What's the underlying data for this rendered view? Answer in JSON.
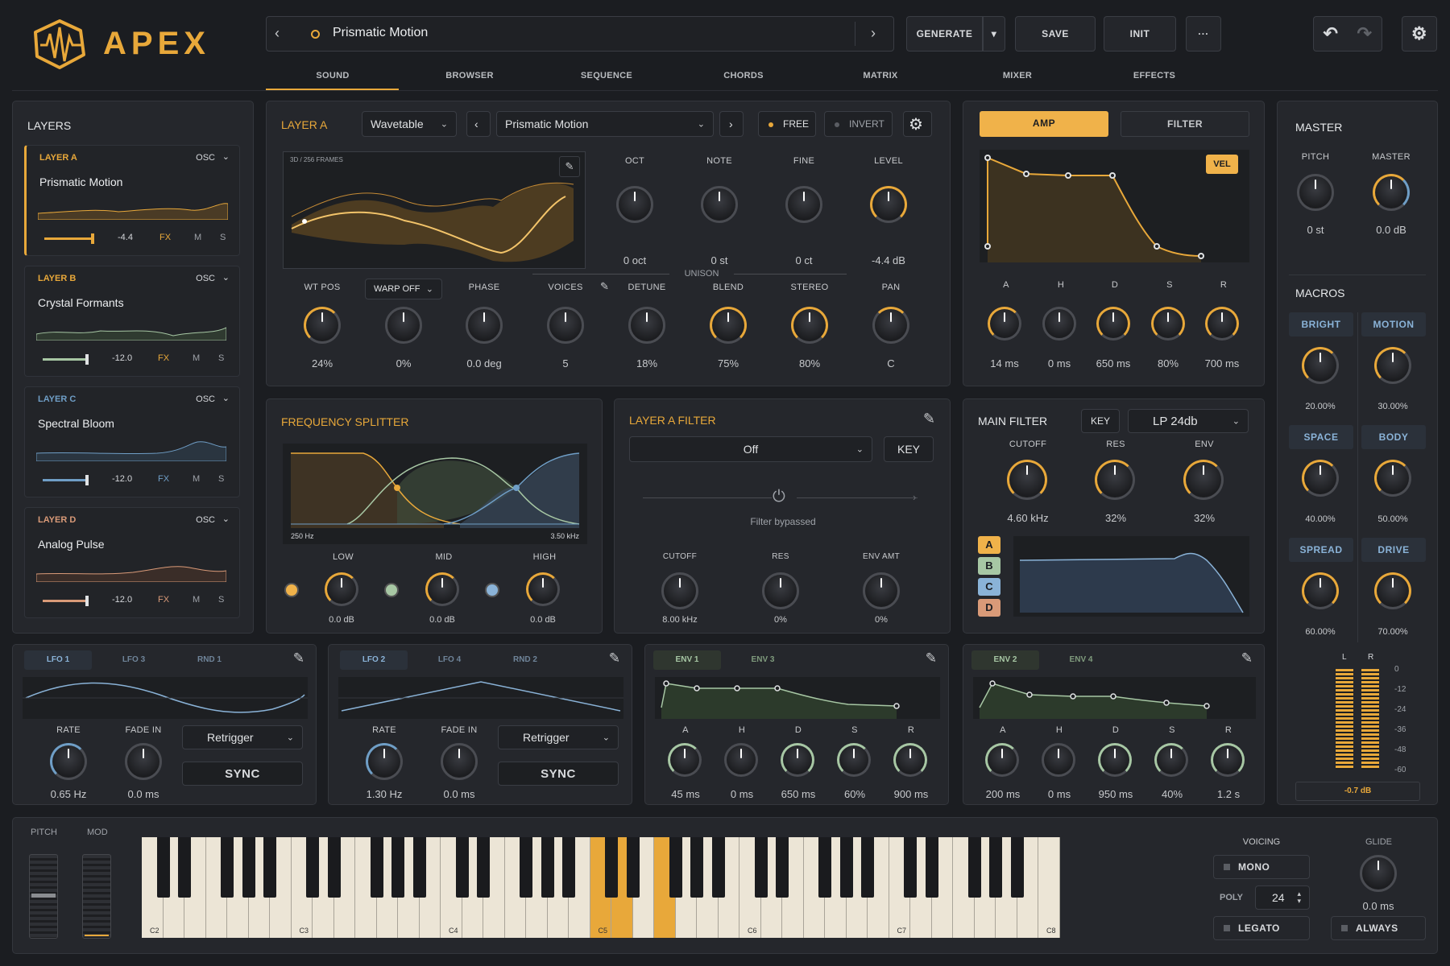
{
  "app": {
    "name": "APEX"
  },
  "colors": {
    "accent": "#e8a83a",
    "bg": "#1b1d21",
    "panel": "#25272c",
    "blue": "#6f9ec6",
    "green": "#a7c7a4",
    "peach": "#d99a78"
  },
  "preset": {
    "name": "Prismatic Motion"
  },
  "toolbar": {
    "generate": "GENERATE",
    "save": "SAVE",
    "init": "INIT",
    "more": "···"
  },
  "tabs": [
    "SOUND",
    "BROWSER",
    "SEQUENCE",
    "CHORDS",
    "MATRIX",
    "MIXER",
    "EFFECTS"
  ],
  "layers": {
    "title": "LAYERS",
    "items": [
      {
        "id": "LAYER A",
        "type": "OSC",
        "name": "Prismatic Motion",
        "level": "-4.4",
        "fx": "FX",
        "m": "M",
        "s": "S"
      },
      {
        "id": "LAYER B",
        "type": "OSC",
        "name": "Crystal Formants",
        "level": "-12.0",
        "fx": "FX",
        "m": "M",
        "s": "S"
      },
      {
        "id": "LAYER C",
        "type": "OSC",
        "name": "Spectral Bloom",
        "level": "-12.0",
        "fx": "FX",
        "m": "M",
        "s": "S"
      },
      {
        "id": "LAYER D",
        "type": "OSC",
        "name": "Analog Pulse",
        "level": "-12.0",
        "fx": "FX",
        "m": "M",
        "s": "S"
      }
    ]
  },
  "layerA": {
    "title": "LAYER A",
    "engine": "Wavetable",
    "wavetable": "Prismatic Motion",
    "free": "FREE",
    "invert": "INVERT",
    "wt_caption": "3D / 256 FRAMES",
    "top_knobs": [
      {
        "label": "OCT",
        "value": "0 oct"
      },
      {
        "label": "NOTE",
        "value": "0 st"
      },
      {
        "label": "FINE",
        "value": "0 ct"
      },
      {
        "label": "LEVEL",
        "value": "-4.4 dB"
      }
    ],
    "unison": "UNISON",
    "warp": "WARP OFF",
    "bottom_knobs": [
      {
        "label": "WT POS",
        "value": "24%"
      },
      {
        "label": "",
        "value": "0%"
      },
      {
        "label": "PHASE",
        "value": "0.0 deg"
      },
      {
        "label": "VOICES",
        "value": "5"
      },
      {
        "label": "DETUNE",
        "value": "18%"
      },
      {
        "label": "BLEND",
        "value": "75%"
      },
      {
        "label": "STEREO",
        "value": "80%"
      },
      {
        "label": "PAN",
        "value": "C"
      }
    ]
  },
  "amp": {
    "tab_amp": "AMP",
    "tab_filter": "FILTER",
    "vel": "VEL",
    "knobs": [
      {
        "label": "A",
        "value": "14 ms"
      },
      {
        "label": "H",
        "value": "0 ms"
      },
      {
        "label": "D",
        "value": "650 ms"
      },
      {
        "label": "S",
        "value": "80%"
      },
      {
        "label": "R",
        "value": "700 ms"
      }
    ]
  },
  "master": {
    "title": "MASTER",
    "pitch_label": "PITCH",
    "pitch": "0 st",
    "master_label": "MASTER",
    "master": "0.0 dB",
    "macros_title": "MACROS",
    "macros": [
      {
        "label": "BRIGHT",
        "value": "20.00%"
      },
      {
        "label": "MOTION",
        "value": "30.00%"
      },
      {
        "label": "SPACE",
        "value": "40.00%"
      },
      {
        "label": "BODY",
        "value": "50.00%"
      },
      {
        "label": "SPREAD",
        "value": "60.00%"
      },
      {
        "label": "DRIVE",
        "value": "70.00%"
      }
    ],
    "meter_l": "L",
    "meter_r": "R",
    "scale": [
      "0",
      "-12",
      "-24",
      "-36",
      "-48",
      "-60"
    ],
    "peak": "-0.7 dB"
  },
  "splitter": {
    "title": "FREQUENCY SPLITTER",
    "lo": "250 Hz",
    "hi": "3.50 kHz",
    "bands": [
      {
        "label": "LOW",
        "value": "0.0 dB"
      },
      {
        "label": "MID",
        "value": "0.0 dB"
      },
      {
        "label": "HIGH",
        "value": "0.0 dB"
      }
    ]
  },
  "layerFilter": {
    "title": "LAYER A FILTER",
    "type": "Off",
    "key": "KEY",
    "bypass": "Filter bypassed",
    "knobs": [
      {
        "label": "CUTOFF",
        "value": "8.00 kHz"
      },
      {
        "label": "RES",
        "value": "0%"
      },
      {
        "label": "ENV AMT",
        "value": "0%"
      }
    ]
  },
  "mainFilter": {
    "title": "MAIN FILTER",
    "key": "KEY",
    "type": "LP 24db",
    "knobs": [
      {
        "label": "CUTOFF",
        "value": "4.60 kHz"
      },
      {
        "label": "RES",
        "value": "32%"
      },
      {
        "label": "ENV",
        "value": "32%"
      }
    ],
    "routes": [
      "A",
      "B",
      "C",
      "D"
    ]
  },
  "mods": [
    {
      "tabs": [
        "LFO 1",
        "LFO 3",
        "RND 1"
      ],
      "k1": {
        "label": "RATE",
        "value": "0.65 Hz"
      },
      "k2": {
        "label": "FADE IN",
        "value": "0.0 ms"
      },
      "mode": "Retrigger",
      "sync": "SYNC"
    },
    {
      "tabs": [
        "LFO 2",
        "LFO 4",
        "RND 2"
      ],
      "k1": {
        "label": "RATE",
        "value": "1.30 Hz"
      },
      "k2": {
        "label": "FADE IN",
        "value": "0.0 ms"
      },
      "mode": "Retrigger",
      "sync": "SYNC"
    }
  ],
  "envs": [
    {
      "tabs": [
        "ENV 1",
        "ENV 3"
      ],
      "knobs": [
        {
          "label": "A",
          "value": "45 ms"
        },
        {
          "label": "H",
          "value": "0 ms"
        },
        {
          "label": "D",
          "value": "650 ms"
        },
        {
          "label": "S",
          "value": "60%"
        },
        {
          "label": "R",
          "value": "900 ms"
        }
      ]
    },
    {
      "tabs": [
        "ENV 2",
        "ENV 4"
      ],
      "knobs": [
        {
          "label": "A",
          "value": "200 ms"
        },
        {
          "label": "H",
          "value": "0 ms"
        },
        {
          "label": "D",
          "value": "950 ms"
        },
        {
          "label": "S",
          "value": "40%"
        },
        {
          "label": "R",
          "value": "1.2 s"
        }
      ]
    }
  ],
  "keyboard": {
    "pitch": "PITCH",
    "mod": "MOD",
    "octaves": [
      "C2",
      "C3",
      "C4",
      "C5",
      "C6",
      "C7",
      "C8"
    ]
  },
  "voicing": {
    "title": "VOICING",
    "mono": "MONO",
    "poly_label": "POLY",
    "poly": "24",
    "legato": "LEGATO",
    "glide_label": "GLIDE",
    "glide": "0.0 ms",
    "always": "ALWAYS"
  }
}
